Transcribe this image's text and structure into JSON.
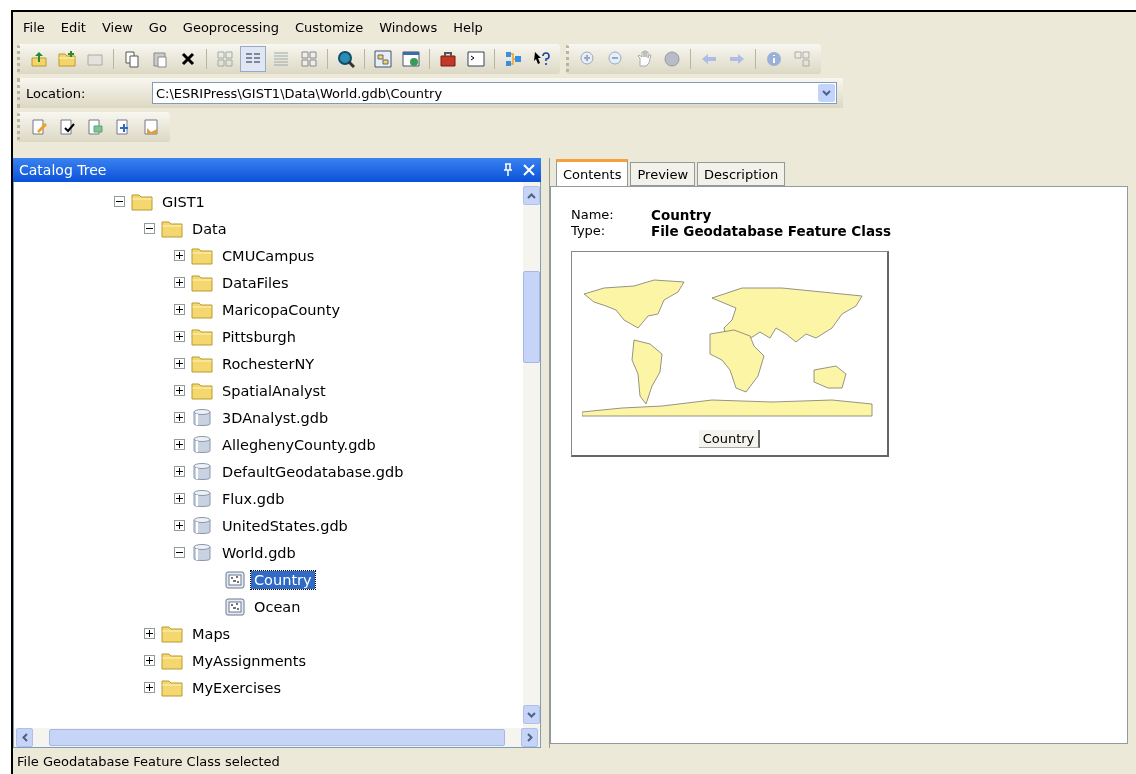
{
  "menu": [
    "File",
    "Edit",
    "View",
    "Go",
    "Geoprocessing",
    "Customize",
    "Windows",
    "Help"
  ],
  "location": {
    "label": "Location:",
    "value": "C:\\ESRIPress\\GIST1\\Data\\World.gdb\\Country"
  },
  "catalog_tree": {
    "title": "Catalog Tree",
    "items": [
      {
        "label": "GIST1",
        "kind": "folder",
        "expanded": true,
        "selected": false,
        "children": [
          {
            "label": "Data",
            "kind": "folder",
            "expanded": true,
            "selected": false,
            "children": [
              {
                "label": "CMUCampus",
                "kind": "folder",
                "expanded": false,
                "selected": false
              },
              {
                "label": "DataFiles",
                "kind": "folder",
                "expanded": false,
                "selected": false
              },
              {
                "label": "MaricopaCounty",
                "kind": "folder",
                "expanded": false,
                "selected": false
              },
              {
                "label": "Pittsburgh",
                "kind": "folder",
                "expanded": false,
                "selected": false
              },
              {
                "label": "RochesterNY",
                "kind": "folder",
                "expanded": false,
                "selected": false
              },
              {
                "label": "SpatialAnalyst",
                "kind": "folder",
                "expanded": false,
                "selected": false
              },
              {
                "label": "3DAnalyst.gdb",
                "kind": "geodatabase",
                "expanded": false,
                "selected": false
              },
              {
                "label": "AlleghenyCounty.gdb",
                "kind": "geodatabase",
                "expanded": false,
                "selected": false
              },
              {
                "label": "DefaultGeodatabase.gdb",
                "kind": "geodatabase",
                "expanded": false,
                "selected": false
              },
              {
                "label": "Flux.gdb",
                "kind": "geodatabase",
                "expanded": false,
                "selected": false
              },
              {
                "label": "UnitedStates.gdb",
                "kind": "geodatabase",
                "expanded": false,
                "selected": false
              },
              {
                "label": "World.gdb",
                "kind": "geodatabase",
                "expanded": true,
                "selected": false,
                "children": [
                  {
                    "label": "Country",
                    "kind": "feature_class",
                    "selected": true
                  },
                  {
                    "label": "Ocean",
                    "kind": "feature_class",
                    "selected": false
                  }
                ]
              }
            ]
          },
          {
            "label": "Maps",
            "kind": "folder",
            "expanded": false,
            "selected": false
          },
          {
            "label": "MyAssignments",
            "kind": "folder",
            "expanded": false,
            "selected": false
          },
          {
            "label": "MyExercises",
            "kind": "folder",
            "expanded": false,
            "selected": false
          }
        ]
      }
    ]
  },
  "tabs": [
    {
      "label": "Contents",
      "selected": true
    },
    {
      "label": "Preview",
      "selected": false
    },
    {
      "label": "Description",
      "selected": false
    }
  ],
  "properties": [
    {
      "label": "Name:",
      "value": "Country"
    },
    {
      "label": "Type:",
      "value": "File Geodatabase Feature Class"
    }
  ],
  "thumbnail": {
    "caption": "Country"
  },
  "status_bar": "File Geodatabase Feature Class selected"
}
